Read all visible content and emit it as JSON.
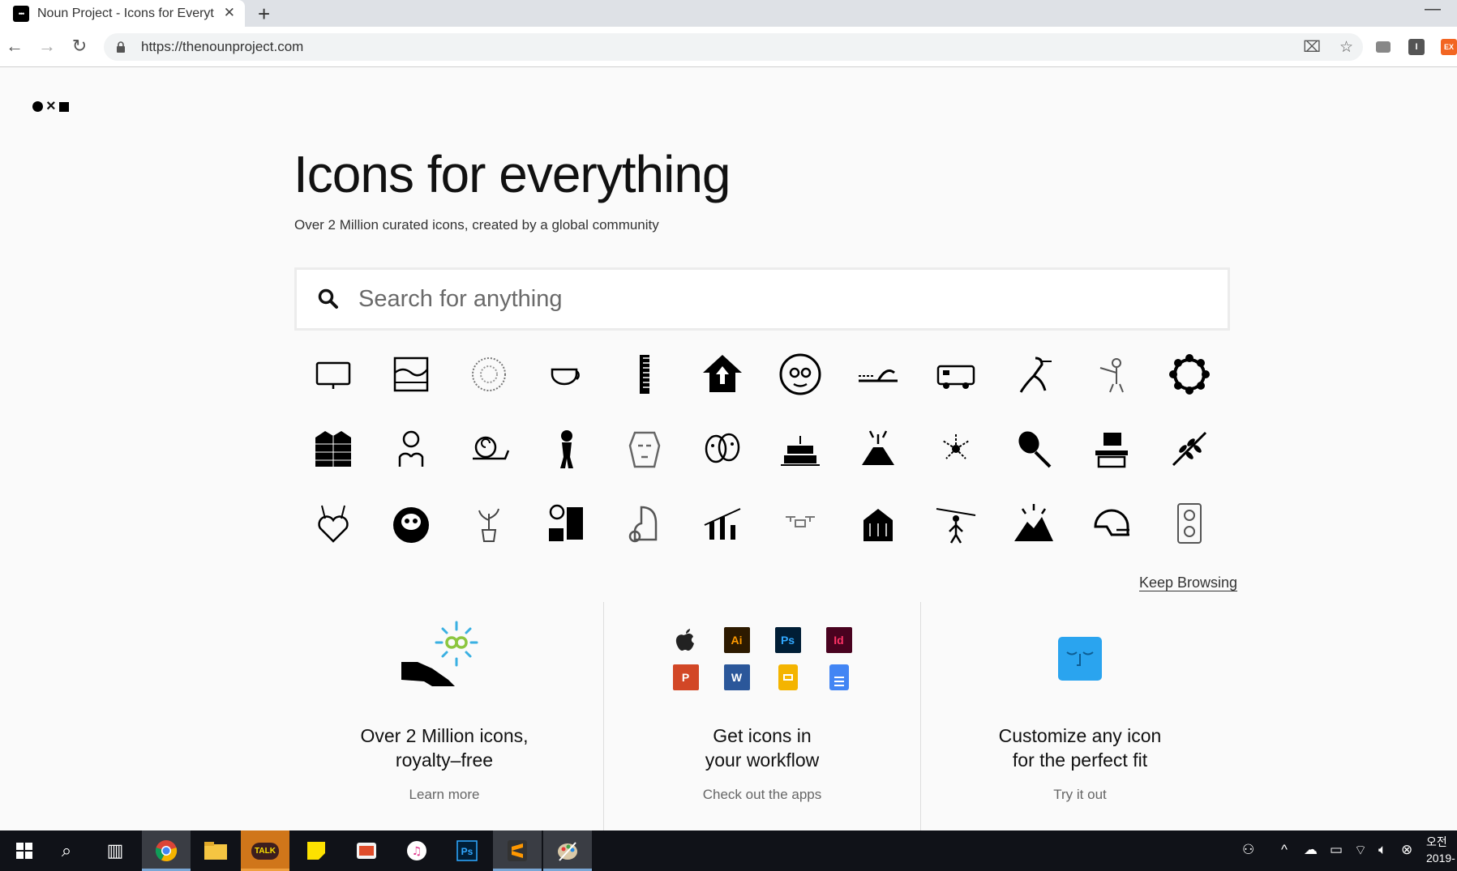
{
  "browser": {
    "tab_title": "Noun Project - Icons for Everyth",
    "tab_favicon": "•••",
    "url": "https://thenounproject.com",
    "extension_labels": [
      "I",
      "EX"
    ]
  },
  "page": {
    "headline": "Icons for everything",
    "subheadline": "Over 2 Million curated icons, created by a global community",
    "search": {
      "placeholder": "Search for anything",
      "value": ""
    },
    "icons": [
      "monitor-icon",
      "landscape-icon",
      "dandelion-icon",
      "teacup-icon",
      "comb-icon",
      "house-arrow-icon",
      "face-glasses-icon",
      "road-sign-icon",
      "camper-van-icon",
      "heron-icon",
      "person-pointing-icon",
      "circle-people-icon",
      "jacket-icon",
      "mind-map-icon",
      "snail-icon",
      "alien-icon",
      "warrior-mask-icon",
      "theater-masks-icon",
      "cake-icon",
      "volcano-icon",
      "fireworks-icon",
      "tennis-racket-icon",
      "shop-icon",
      "branch-icon",
      "heart-flowers-icon",
      "daruma-icon",
      "potted-plant-icon",
      "teamwork-icon",
      "dog-cup-icon",
      "candles-icon",
      "drone-icon",
      "burning-building-icon",
      "zipline-icon",
      "mountain-sunrise-icon",
      "football-helmet-icon",
      "power-outlet-icon"
    ],
    "keep_browsing": "Keep Browsing",
    "features": [
      {
        "title_line1": "Over 2 Million icons,",
        "title_line2": "royalty–free",
        "link": "Learn more"
      },
      {
        "title_line1": "Get icons in",
        "title_line2": "your workflow",
        "link": "Check out the apps",
        "apps": [
          {
            "label": "",
            "name": "apple-icon",
            "bg": "transparent",
            "fg": "#222"
          },
          {
            "label": "Ai",
            "name": "illustrator-icon",
            "bg": "#2d1a00",
            "fg": "#ff9a00"
          },
          {
            "label": "Ps",
            "name": "photoshop-icon",
            "bg": "#001e36",
            "fg": "#31a8ff"
          },
          {
            "label": "Id",
            "name": "indesign-icon",
            "bg": "#49021f",
            "fg": "#ff3366"
          },
          {
            "label": "P",
            "name": "powerpoint-icon",
            "bg": "#d24726",
            "fg": "#ffffff"
          },
          {
            "label": "W",
            "name": "word-icon",
            "bg": "#2b579a",
            "fg": "#ffffff"
          },
          {
            "label": "",
            "name": "google-slides-icon",
            "bg": "#f4b400",
            "fg": "#ffffff"
          },
          {
            "label": "",
            "name": "google-docs-icon",
            "bg": "#4285f4",
            "fg": "#ffffff"
          }
        ]
      },
      {
        "title_line1": "Customize any icon",
        "title_line2": "for the perfect fit",
        "link": "Try it out"
      }
    ]
  },
  "taskbar": {
    "clock_line1": "오전",
    "clock_line2": "2019-",
    "kakao_label": "TALK"
  },
  "colors": {
    "customize_blue": "#2aa4ef",
    "infinity_blue": "#3ab0e2",
    "infinity_green": "#8cc63f"
  }
}
